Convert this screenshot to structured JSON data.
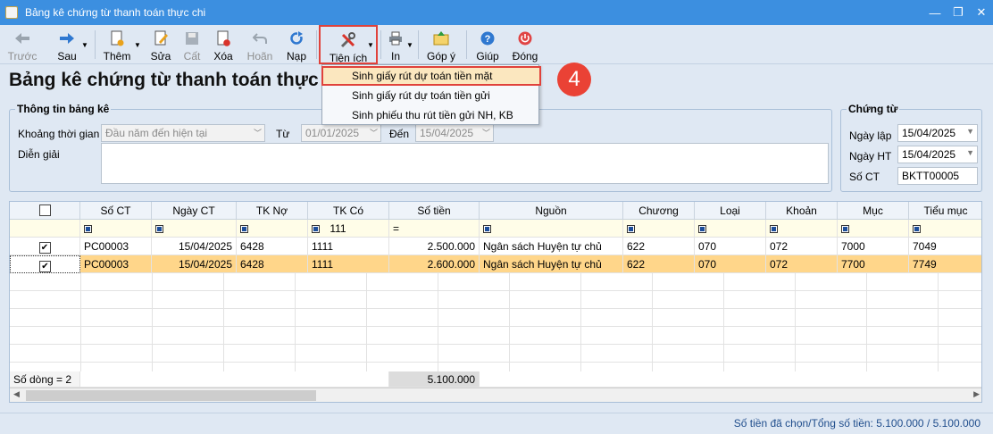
{
  "window": {
    "title": "Bảng kê chứng từ thanh toán thực chi",
    "min": "—",
    "max": "❐",
    "close": "✕"
  },
  "toolbar": {
    "prev": "Trước",
    "next": "Sau",
    "add": "Thêm",
    "edit": "Sửa",
    "save": "Cất",
    "delete": "Xóa",
    "undo": "Hoãn",
    "reload": "Nạp",
    "utilities": "Tiện ích",
    "print": "In",
    "feedback": "Góp ý",
    "help": "Giúp",
    "close": "Đóng"
  },
  "heading": "Bảng kê chứng từ thanh toán thực",
  "menu": {
    "items": [
      "Sinh giấy rút dự toán tiền mặt",
      "Sinh giấy rút dự toán tiền gửi",
      "Sinh phiếu thu rút tiền gửi NH, KB"
    ]
  },
  "badge": "4",
  "info": {
    "legend": "Thông tin bảng kê",
    "period_label": "Khoảng thời gian",
    "period_value": "Đầu năm đến hiện tại",
    "from_label": "Từ",
    "from_value": "01/01/2025",
    "to_label": "Đến",
    "to_value": "15/04/2025",
    "desc_label": "Diễn giải",
    "desc_value": ""
  },
  "voucher": {
    "legend": "Chứng từ",
    "date_label": "Ngày lập",
    "date_value": "15/04/2025",
    "post_label": "Ngày HT",
    "post_value": "15/04/2025",
    "no_label": "Số CT",
    "no_value": "BKTT00005"
  },
  "grid": {
    "columns": [
      "",
      "Số CT",
      "Ngày CT",
      "TK Nợ",
      "TK Có",
      "Số tiền",
      "Nguồn",
      "Chương",
      "Loại",
      "Khoản",
      "Mục",
      "Tiểu mục"
    ],
    "filter": {
      "tk_co": "111",
      "so_tien": "="
    },
    "rows": [
      [
        "✔",
        "PC00003",
        "15/04/2025",
        "6428",
        "1111",
        "2.500.000",
        "Ngân sách Huyện tự chủ",
        "622",
        "070",
        "072",
        "7000",
        "7049"
      ],
      [
        "✔",
        "PC00003",
        "15/04/2025",
        "6428",
        "1111",
        "2.600.000",
        "Ngân sách Huyện tự chủ",
        "622",
        "070",
        "072",
        "7700",
        "7749"
      ]
    ],
    "footer_count": "Số dòng = 2",
    "footer_total": "5.100.000"
  },
  "status": "Số tiền đã chọn/Tổng số tiền: 5.100.000 / 5.100.000"
}
